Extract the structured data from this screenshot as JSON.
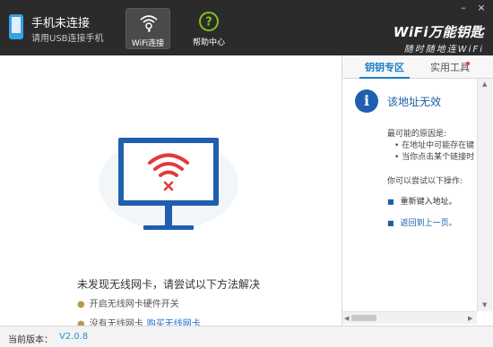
{
  "titlebar": {
    "phone_status": "手机未连接",
    "phone_hint": "请用USB连接手机",
    "tabs": [
      {
        "label": "WiFi连接",
        "icon": "wifi-key-icon",
        "active": true
      },
      {
        "label": "帮助中心",
        "icon": "help-icon",
        "active": false
      }
    ],
    "brand_name": "WiFi万能钥匙",
    "brand_slogan": "随时随地连WiFi",
    "window_controls": {
      "minimize": "–",
      "close": "×"
    }
  },
  "main": {
    "illustration": "monitor-wifi-error-icon",
    "hint_title": "未发现无线网卡，请尝试以下方法解决",
    "tips": [
      {
        "text": "开启无线网卡硬件开关",
        "link": ""
      },
      {
        "text": "没有无线网卡",
        "link": "购买无线网卡"
      }
    ]
  },
  "side": {
    "tabs": [
      {
        "label": "钥钥专区",
        "active": true
      },
      {
        "label": "实用工具",
        "active": false,
        "badge": true
      }
    ],
    "icon": "info-icon",
    "title": "该地址无效",
    "reasons_heading": "最可能的原因是:",
    "reasons": [
      "在地址中可能存在键",
      "当你点击某个链接时"
    ],
    "try_heading": "你可以尝试以下操作:",
    "actions": [
      "重新键入地址。",
      "返回到上一页。"
    ]
  },
  "status": {
    "version_label": "当前版本：",
    "version_value": "V2.0.8"
  },
  "colors": {
    "titlebar_bg": "#2b2b2b",
    "accent_blue": "#1a7ec8",
    "wifi_red": "#e03b3b",
    "help_green": "#7ec21b"
  }
}
